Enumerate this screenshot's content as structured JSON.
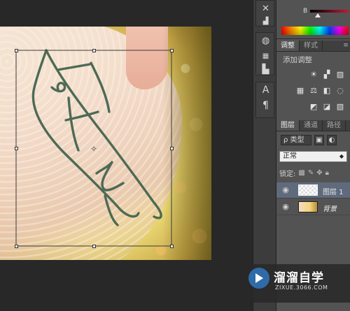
{
  "color_panel": {
    "channel_label": "B",
    "b_value_fraction": 0.2
  },
  "adjust_panel": {
    "tabs": [
      {
        "label": "调整",
        "active": true
      },
      {
        "label": "样式",
        "active": false
      }
    ],
    "title": "添加调整",
    "icons": [
      "brightness-icon",
      "levels-icon",
      "curves-icon",
      "exposure-icon",
      "vibrance-icon",
      "color-balance-icon",
      "bw-icon",
      "photo-filter-icon",
      "invert-icon",
      "posterize-icon",
      "threshold-icon",
      "gradient-map-icon"
    ]
  },
  "layers_panel": {
    "tabs": [
      {
        "label": "图层",
        "active": true
      },
      {
        "label": "通道",
        "active": false
      },
      {
        "label": "路径",
        "active": false
      }
    ],
    "filter_label": "ρ 类型",
    "blend_mode": "正常",
    "lock_label": "锁定:",
    "layers": [
      {
        "name": "图层 1",
        "selected": true,
        "visible": true
      },
      {
        "name": "背景",
        "selected": false,
        "visible": true,
        "italic": true
      }
    ]
  },
  "watermark": {
    "title": "溜溜自学",
    "subtitle": "ZIXUE.3066.COM"
  }
}
